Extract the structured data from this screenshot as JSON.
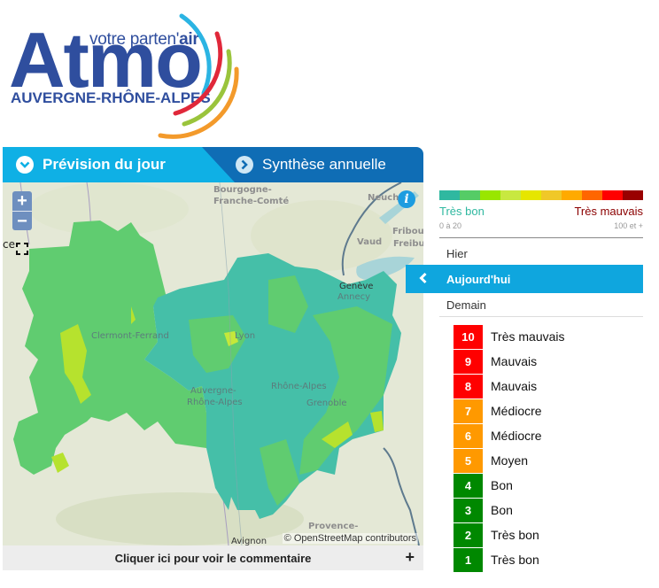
{
  "logo": {
    "tagline_prefix": "votre parten'",
    "tagline_bold": "air",
    "brand": "Atmo",
    "region": "AUVERGNE-RHÔNE-ALPES",
    "arc_colors": [
      "#2bb4e3",
      "#e0283a",
      "#9ac43c",
      "#f39a2b"
    ]
  },
  "tabs": [
    {
      "label": "Prévision du jour",
      "icon": "chevron-down-circle-icon",
      "active": true
    },
    {
      "label": "Synthèse annuelle",
      "icon": "chevron-right-circle-icon",
      "active": false
    }
  ],
  "map": {
    "zoom_in": "+",
    "zoom_out": "−",
    "info": "i",
    "edge_label": "ce",
    "places": {
      "bourgogne": "Bourgogne-",
      "franche": "Franche-Comté",
      "neuch": "Neuch",
      "vaud": "Vaud",
      "fribourg": "Fribour",
      "freiburg": "Freibu",
      "geneve": "Genève",
      "annecy": "Annecy",
      "clermont": "Clermont-Ferrand",
      "lyon": "Lyon",
      "auvergne1": "Auvergne-",
      "auvergne2": "Rhône-Alpes",
      "rhone_alpes": "Rhône-Alpes",
      "grenoble": "Grenoble",
      "provence": "Provence-",
      "avignon": "Avignon"
    },
    "attribution": "© OpenStreetMap contributors"
  },
  "comment_bar": {
    "label": "Cliquer ici pour voir le commentaire",
    "toggle": "+"
  },
  "legend": {
    "scale_colors": [
      "#2fb8a0",
      "#55cc66",
      "#99e600",
      "#c8e840",
      "#e6e600",
      "#f0c828",
      "#ffaa00",
      "#ff6600",
      "#ff0000",
      "#990000"
    ],
    "low_label": "Très bon",
    "low_range": "0 à 20",
    "high_label": "Très mauvais",
    "high_range": "100 et +",
    "low_color": "#2fb8a0",
    "high_color": "#8b0000"
  },
  "days": [
    {
      "label": "Hier",
      "active": false
    },
    {
      "label": "Aujourd'hui",
      "active": true
    },
    {
      "label": "Demain",
      "active": false
    }
  ],
  "index_scale": [
    {
      "value": "10",
      "label": "Très mauvais",
      "color": "#ff0000"
    },
    {
      "value": "9",
      "label": "Mauvais",
      "color": "#ff0000"
    },
    {
      "value": "8",
      "label": "Mauvais",
      "color": "#ff0000"
    },
    {
      "value": "7",
      "label": "Médiocre",
      "color": "#ff9900"
    },
    {
      "value": "6",
      "label": "Médiocre",
      "color": "#ff9900"
    },
    {
      "value": "5",
      "label": "Moyen",
      "color": "#ff9900"
    },
    {
      "value": "4",
      "label": "Bon",
      "color": "#008800"
    },
    {
      "value": "3",
      "label": "Bon",
      "color": "#008800"
    },
    {
      "value": "2",
      "label": "Très bon",
      "color": "#008800"
    },
    {
      "value": "1",
      "label": "Très bon",
      "color": "#008800"
    }
  ]
}
